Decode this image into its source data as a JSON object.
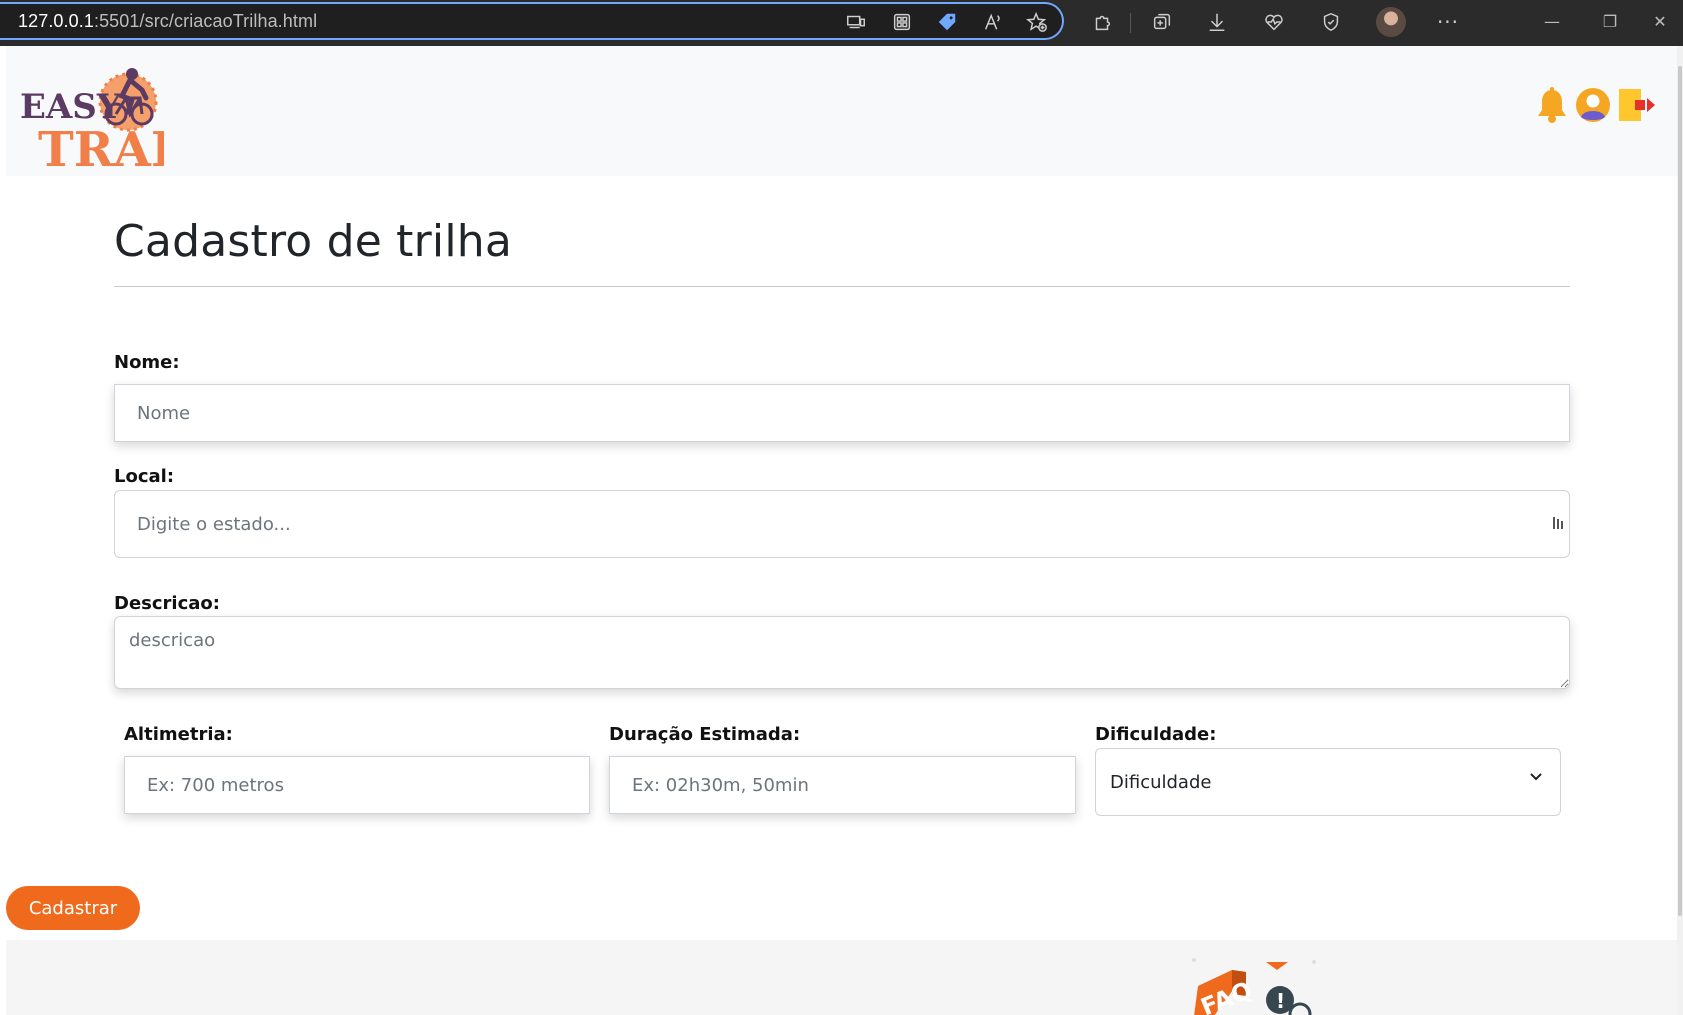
{
  "browser": {
    "url_host": "127.0.0.1",
    "url_rest": ":5501/src/criacaoTrilha.html"
  },
  "header": {
    "logo_text_top": "EASY",
    "logo_text_bottom": "TRAIL"
  },
  "form": {
    "title": "Cadastro de trilha",
    "nome_label": "Nome:",
    "nome_placeholder": "Nome",
    "local_label": "Local:",
    "local_placeholder": "Digite o estado...",
    "descricao_label": "Descricao:",
    "descricao_placeholder": "descricao",
    "altimetria_label": "Altimetria:",
    "altimetria_placeholder": "Ex: 700 metros",
    "duracao_label": "Duração Estimada:",
    "duracao_placeholder": "Ex: 02h30m, 50min",
    "dificuldade_label": "Dificuldade:",
    "dificuldade_selected": "Dificuldade",
    "submit_label": "Cadastrar"
  },
  "footer": {
    "faq_text": "FAQ"
  },
  "colors": {
    "accent": "#f06a1d",
    "bell": "#f5a623",
    "logo_purple": "#5b3b63",
    "logo_orange": "#f07f49"
  }
}
